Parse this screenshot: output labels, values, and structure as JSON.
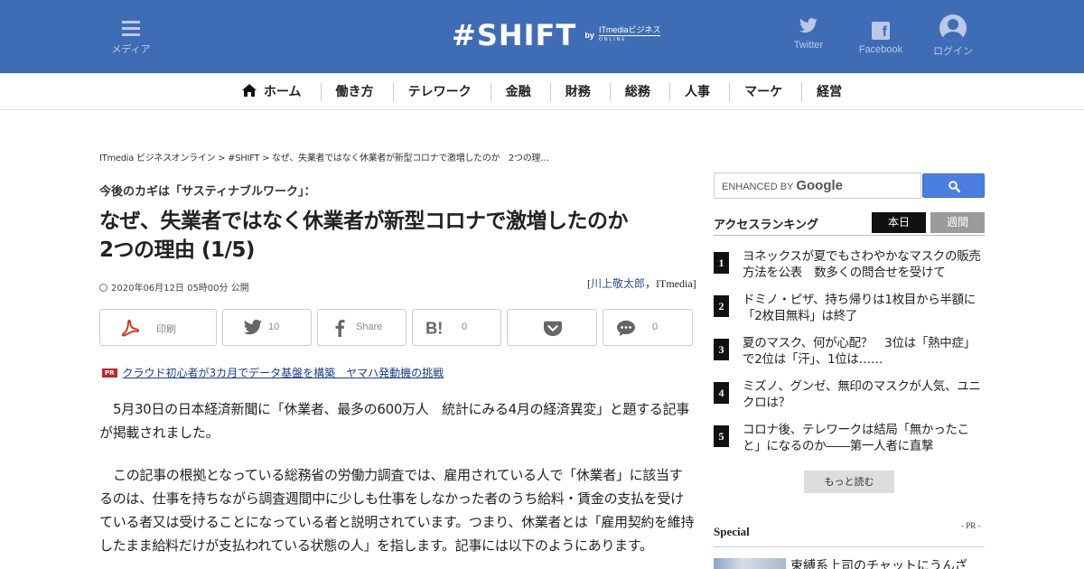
{
  "header": {
    "menu_label": "メディア",
    "twitter_label": "Twitter",
    "facebook_label": "Facebook",
    "login_label": "ログイン",
    "logo_text": "#SHIFT",
    "logo_by": "by",
    "logo_sub": "ITmediaビジネス",
    "logo_sub2": "ONLINE"
  },
  "nav": {
    "items": [
      "ホーム",
      "働き方",
      "テレワーク",
      "金融",
      "財務",
      "総務",
      "人事",
      "マーケ",
      "経営"
    ]
  },
  "article": {
    "breadcrumb": "ITmedia ビジネスオンライン > #SHIFT > なぜ、失業者ではなく休業者が新型コロナで激増したのか　2つの理…",
    "kicker": "今後のカギは「サスティナブルワーク」：",
    "title_line1": "なぜ、失業者ではなく休業者が新型コロナで激増したのか",
    "title_line2": "2つの理由 (1/5)",
    "pubdate": "2020年06月12日 05時00分 公開",
    "author_prefix": "[",
    "author_name": "川上敬太郎",
    "author_suffix": "，ITmedia]",
    "share": {
      "print": "印刷",
      "twitter_count": "10",
      "facebook": "Share",
      "hatena_count": "0",
      "comment_count": "0"
    },
    "pr_badge": "PR",
    "pr_text": "クラウド初心者が3カ月でデータ基盤を構築　ヤマハ発動機の挑戦",
    "p1": "5月30日の日本経済新聞に「休業者、最多の600万人　統計にみる4月の経済異変」と題する記事が掲載されました。",
    "p2": "この記事の根拠となっている総務省の労働力調査では、雇用されている人で「休業者」に該当するのは、仕事を持ちながら調査週間中に少しも仕事をしなかった者のうち給料・賃金の支払を受けている者又は受けることになっている者と説明されています。つまり、休業者とは「雇用契約を維持したまま給料だけが支払われている状態の人」を指します。記事には以下のようにあります。"
  },
  "sidebar": {
    "search_placeholder": "ENHANCED BY",
    "search_brand": "Google",
    "ranking_title": "アクセスランキング",
    "tab_today": "本日",
    "tab_week": "週間",
    "ranking": [
      {
        "num": "1",
        "title": "ヨネックスが夏でもさわやかなマスクの販売方法を公表　数多くの問合せを受けて"
      },
      {
        "num": "2",
        "title": "ドミノ・ピザ、持ち帰りは1枚目から半額に　「2枚目無料」は終了"
      },
      {
        "num": "3",
        "title": "夏のマスク、何が心配？　3位は「熱中症」で2位は「汗」、1位は……"
      },
      {
        "num": "4",
        "title": "ミズノ、グンゼ、無印のマスクが人気、ユニクロは？"
      },
      {
        "num": "5",
        "title": "コロナ後、テレワークは結局「無かったこと」になるのか――第一人者に直撃"
      }
    ],
    "more_label": "もっと読む",
    "special_title": "Special",
    "special_pr": "- PR -",
    "special_item": "束縛系上司のチャットにうんざ"
  }
}
